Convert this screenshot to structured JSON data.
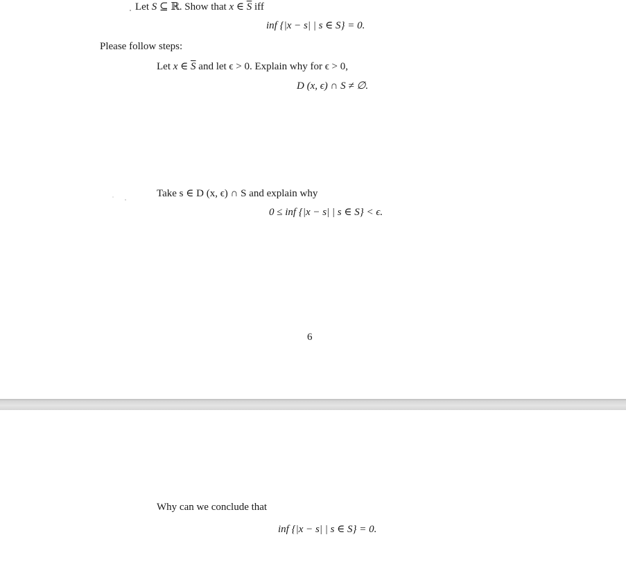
{
  "page1": {
    "problem": {
      "prefix": "Let ",
      "S1": "S",
      "subset": " ⊆ ℝ. Show that ",
      "x": "x",
      "in": " ∈ ",
      "Sbar": "S",
      "iff": " iff"
    },
    "eq1": "inf {|x − s|  | s ∈ S} = 0.",
    "follow_steps": "Please follow steps:",
    "step1": {
      "text_a": "Let ",
      "x": "x",
      "in": " ∈ ",
      "Sbar": "S",
      "text_b": " and let ϵ > 0. Explain why for ϵ > 0,"
    },
    "eq2": "D (x, ϵ) ∩ S ≠ ∅.",
    "step2": "Take s ∈ D (x, ϵ) ∩ S and explain why",
    "eq3": "0 ≤ inf {|x − s|  | s ∈ S} < ϵ.",
    "page_number": "6"
  },
  "page2": {
    "step3": "Why can we conclude that",
    "eq4": "inf {|x − s|  | s ∈ S} = 0."
  }
}
